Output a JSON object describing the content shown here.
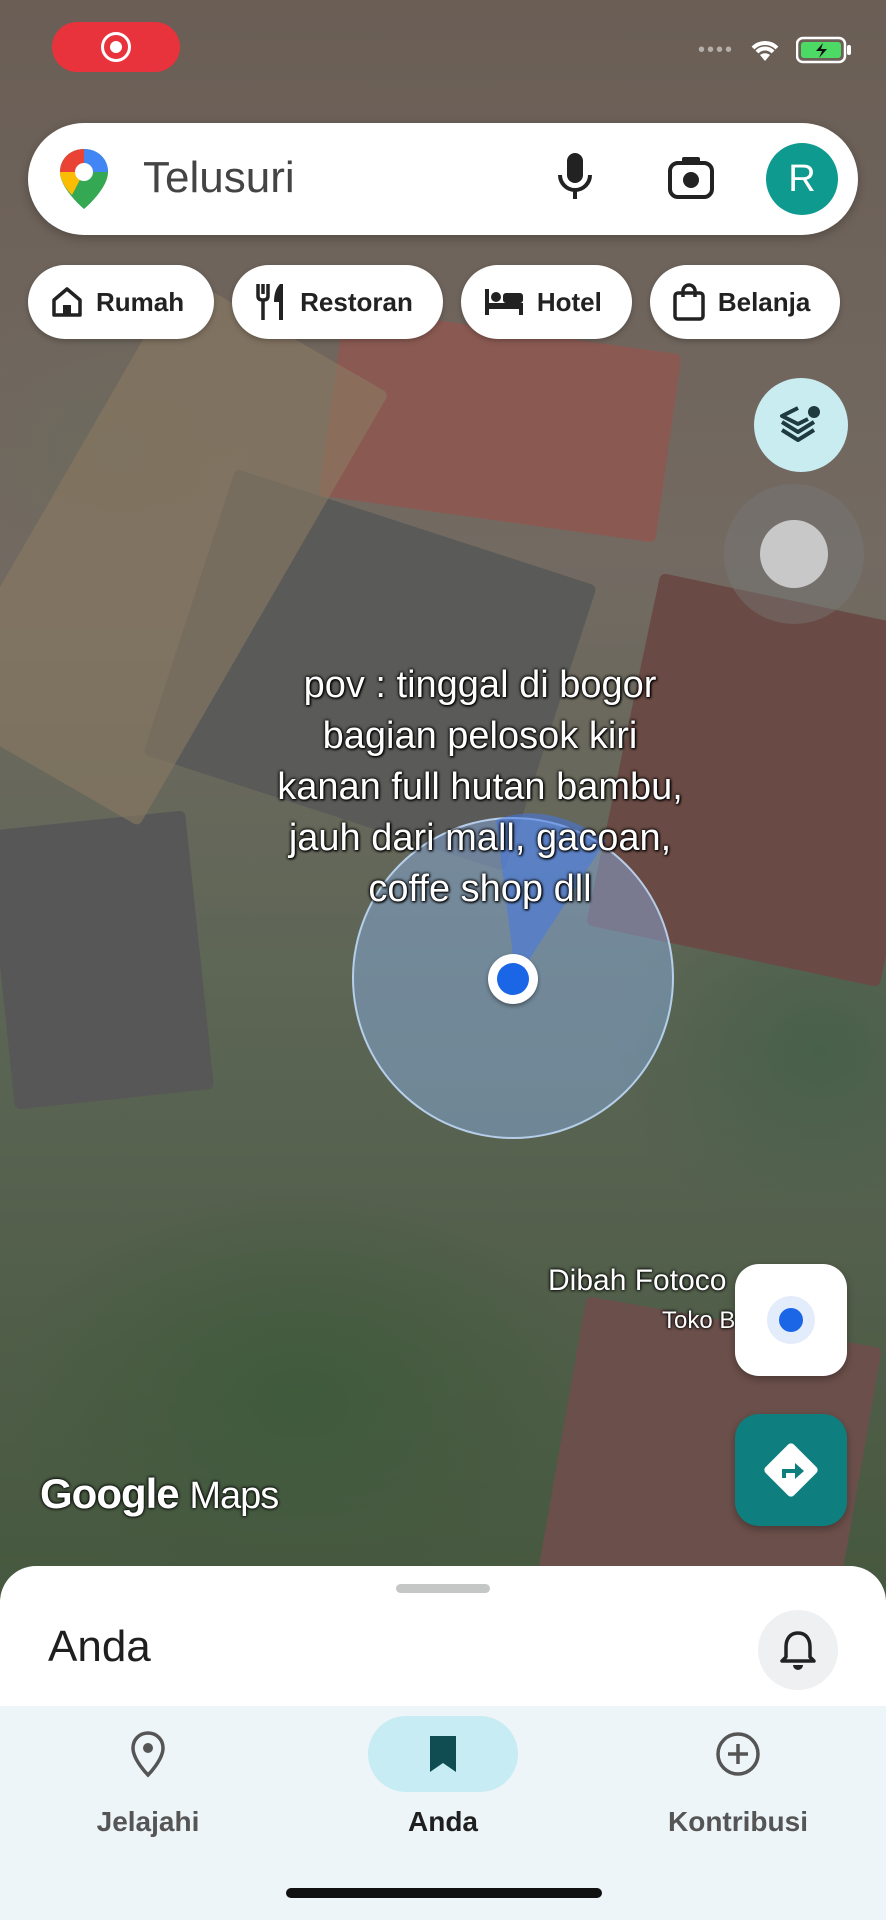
{
  "search": {
    "placeholder": "Telusuri",
    "avatar_letter": "R"
  },
  "chips": [
    {
      "label": "Rumah",
      "icon": "home-icon"
    },
    {
      "label": "Restoran",
      "icon": "restaurant-icon"
    },
    {
      "label": "Hotel",
      "icon": "hotel-icon"
    },
    {
      "label": "Belanja",
      "icon": "shopping-bag-icon"
    }
  ],
  "caption": {
    "line1": "pov : tinggal di bogor",
    "line2": "bagian pelosok kiri",
    "line3": "kanan full hutan bambu,",
    "line4": "jauh dari mall, gacoan,",
    "line5": "coffe shop dll"
  },
  "map": {
    "place_name": "Dibah Fotoco",
    "place_sub": "Toko B",
    "brand_google": "Google",
    "brand_maps": "Maps"
  },
  "sheet": {
    "title": "Anda"
  },
  "nav": [
    {
      "label": "Jelajahi",
      "icon": "location-pin-icon",
      "active": false
    },
    {
      "label": "Anda",
      "icon": "bookmark-icon",
      "active": true
    },
    {
      "label": "Kontribusi",
      "icon": "add-circle-icon",
      "active": false
    }
  ],
  "colors": {
    "accent": "#0e7f7e",
    "avatar": "#0e9a8e",
    "location_dot": "#1b66e6",
    "record": "#e8323c"
  }
}
